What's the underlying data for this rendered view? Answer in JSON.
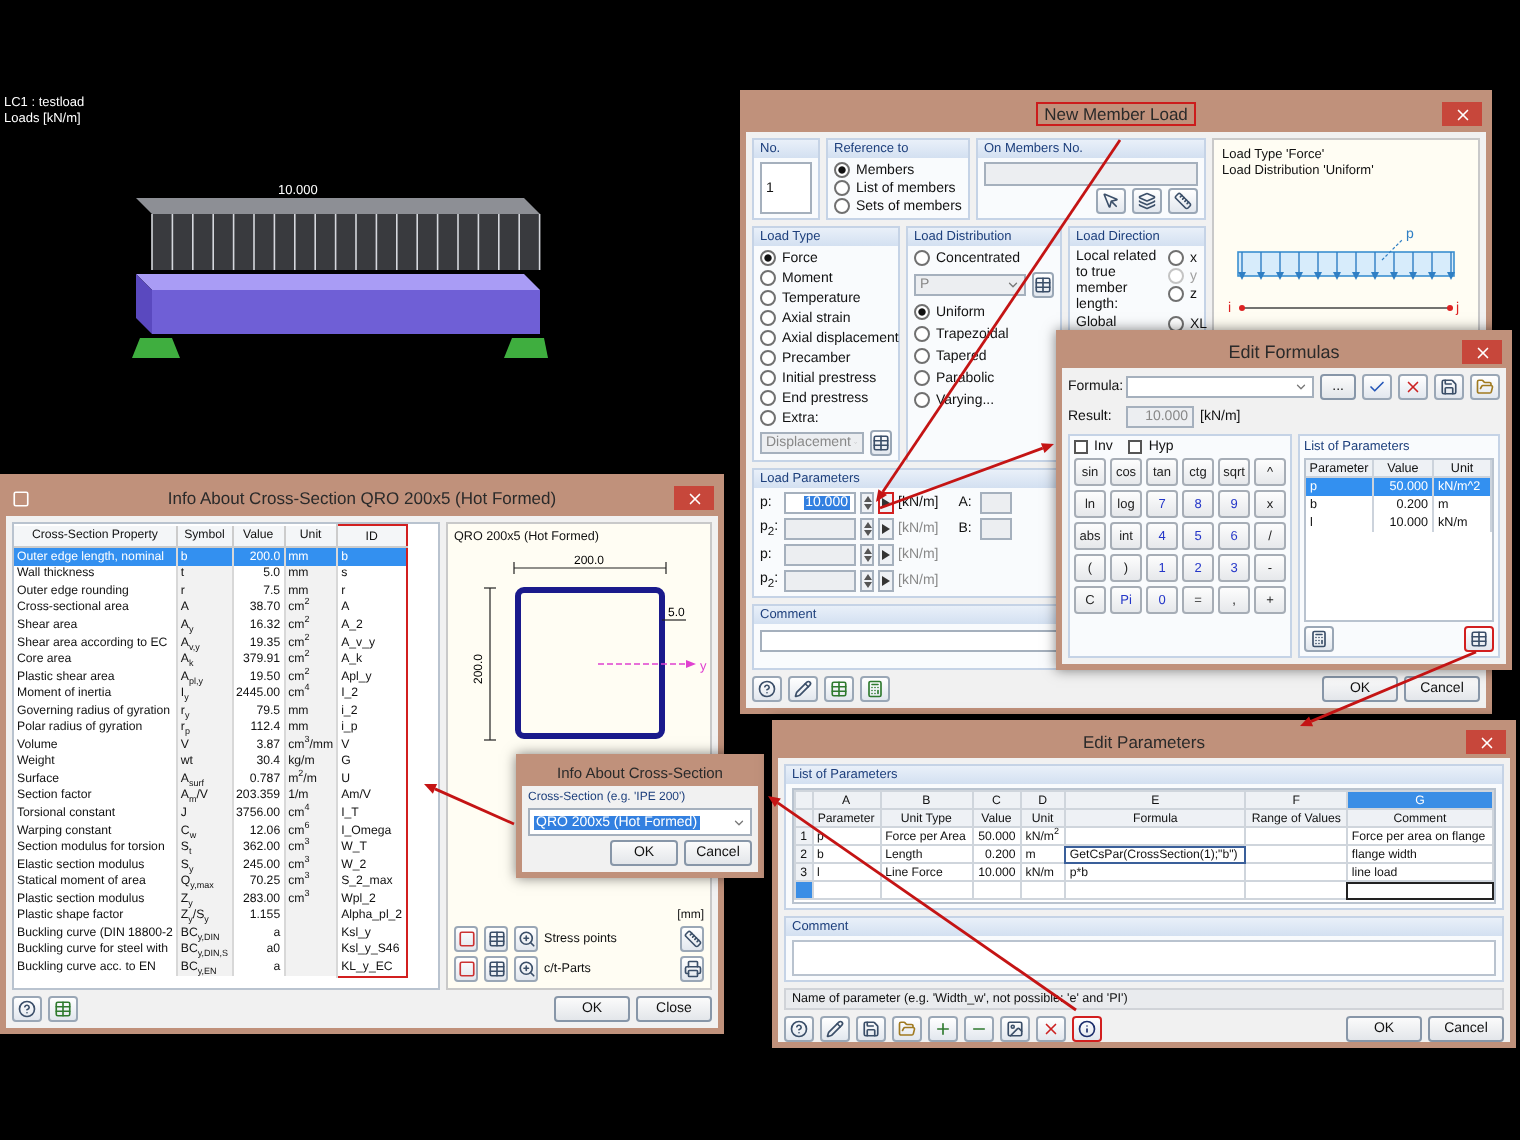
{
  "viewport": {
    "case_label": "LC1 : testload",
    "units_label": "Loads [kN/m]",
    "load_value": "10.000"
  },
  "member_load_dialog": {
    "title": "New Member Load",
    "title_highlighted": true,
    "number": {
      "label": "No.",
      "value": "1"
    },
    "reference": {
      "label": "Reference to",
      "options": [
        {
          "label": "Members",
          "selected": true
        },
        {
          "label": "List of members",
          "selected": false
        },
        {
          "label": "Sets of members",
          "selected": false
        }
      ]
    },
    "members": {
      "label": "On Members No."
    },
    "load_type": {
      "label": "Load Type",
      "options": [
        {
          "label": "Force",
          "selected": true
        },
        {
          "label": "Moment",
          "selected": false
        },
        {
          "label": "Temperature",
          "selected": false
        },
        {
          "label": "Axial strain",
          "selected": false
        },
        {
          "label": "Axial displacement",
          "selected": false
        },
        {
          "label": "Precamber",
          "selected": false
        },
        {
          "label": "Initial prestress",
          "selected": false
        },
        {
          "label": "End prestress",
          "selected": false
        },
        {
          "label": "Extra:",
          "selected": false,
          "value": "Displacement"
        }
      ]
    },
    "load_distribution": {
      "label": "Load Distribution",
      "options": [
        {
          "label": "Concentrated",
          "selected": false,
          "value": "P"
        },
        {
          "label": "Uniform",
          "selected": true
        },
        {
          "label": "Trapezoidal",
          "selected": false
        },
        {
          "label": "Tapered",
          "selected": false
        },
        {
          "label": "Parabolic",
          "selected": false
        },
        {
          "label": "Varying...",
          "selected": false
        }
      ]
    },
    "load_direction": {
      "label": "Load Direction",
      "local_label": "Local related to true member length:",
      "local_options": [
        {
          "label": "x",
          "selected": false,
          "disabled": false
        },
        {
          "label": "y",
          "selected": false,
          "disabled": true
        },
        {
          "label": "z",
          "selected": false,
          "disabled": false
        }
      ],
      "global_label": "Global",
      "global_options": [
        {
          "label": "XL",
          "selected": false,
          "disabled": false
        }
      ]
    },
    "load_parameters": {
      "label": "Load Parameters",
      "rows": [
        {
          "label": "p:",
          "value": "10.000",
          "unit": "[kN/m]",
          "disabled": false,
          "formula_highlighted": true
        },
        {
          "label": "p$_{2}$:",
          "unit": "[kN/m]",
          "disabled": true,
          "formula_highlighted": false
        },
        {
          "label": "p:",
          "unit": "[kN/m]",
          "disabled": true,
          "formula_highlighted": false
        },
        {
          "label": "p$_{2}$:",
          "unit": "[kN/m]",
          "disabled": true,
          "formula_highlighted": false
        }
      ],
      "distances": [
        {
          "label": "A:"
        },
        {
          "label": "B:"
        }
      ]
    },
    "comment": {
      "label": "Comment"
    },
    "preview": {
      "lines": [
        "Load Type 'Force'",
        "Load Distribution 'Uniform'"
      ],
      "load_symbol": "p",
      "start_node": "i",
      "end_node": "j"
    },
    "buttons": [
      "OK",
      "Cancel"
    ]
  },
  "formula_dialog": {
    "title": "Edit Formulas",
    "formula_label": "Formula:",
    "more_button": "...",
    "result_label": "Result:",
    "result_value": "10.000",
    "result_unit": "[kN/m]",
    "parameters_button_highlighted": true,
    "checks": [
      {
        "label": "Inv",
        "checked": false
      },
      {
        "label": "Hyp",
        "checked": false
      }
    ],
    "keys": [
      [
        {
          "label": "sin",
          "kind": "function"
        },
        {
          "label": "cos",
          "kind": "function"
        },
        {
          "label": "tan",
          "kind": "function"
        },
        {
          "label": "ctg",
          "kind": "function"
        },
        {
          "label": "sqrt",
          "kind": "function"
        },
        {
          "label": "^",
          "kind": "operator"
        }
      ],
      [
        {
          "label": "ln",
          "kind": "function"
        },
        {
          "label": "log",
          "kind": "function"
        },
        {
          "label": "7",
          "kind": "digit"
        },
        {
          "label": "8",
          "kind": "digit"
        },
        {
          "label": "9",
          "kind": "digit"
        },
        {
          "label": "x",
          "kind": "operator"
        }
      ],
      [
        {
          "label": "abs",
          "kind": "function"
        },
        {
          "label": "int",
          "kind": "function"
        },
        {
          "label": "4",
          "kind": "digit"
        },
        {
          "label": "5",
          "kind": "digit"
        },
        {
          "label": "6",
          "kind": "digit"
        },
        {
          "label": "/",
          "kind": "operator"
        }
      ],
      [
        {
          "label": "(",
          "kind": "operator"
        },
        {
          "label": ")",
          "kind": "operator"
        },
        {
          "label": "1",
          "kind": "digit"
        },
        {
          "label": "2",
          "kind": "digit"
        },
        {
          "label": "3",
          "kind": "digit"
        },
        {
          "label": "-",
          "kind": "operator"
        }
      ],
      [
        {
          "label": "C",
          "kind": "operator"
        },
        {
          "label": "Pi",
          "kind": "digit"
        },
        {
          "label": "0",
          "kind": "digit"
        },
        {
          "label": "=",
          "kind": "operator"
        },
        {
          "label": ",",
          "kind": "operator"
        },
        {
          "label": "+",
          "kind": "operator"
        }
      ]
    ],
    "parameters": {
      "title": "List of Parameters",
      "columns": [
        "Parameter",
        "Value",
        "Unit"
      ],
      "rows": [
        {
          "cells": [
            "p",
            "50.000",
            "kN/m^2"
          ],
          "selected": true
        },
        {
          "cells": [
            "b",
            "0.200",
            "m"
          ],
          "selected": false
        },
        {
          "cells": [
            "l",
            "10.000",
            "kN/m"
          ],
          "selected": false
        }
      ]
    }
  },
  "section_info": {
    "title": "Info About Cross-Section QRO 200x5 (Hot Formed)",
    "id_column_highlighted": true,
    "columns": [
      "Cross-Section Property",
      "Symbol",
      "Value",
      "Unit",
      "ID"
    ],
    "rows": [
      {
        "property": "Outer edge length, nominal",
        "symbol": "b",
        "value": "200.0",
        "unit": "mm",
        "id": "b",
        "selected": true
      },
      {
        "property": "Wall thickness",
        "symbol": "t",
        "value": "5.0",
        "unit": "mm",
        "id": "s",
        "selected": false
      },
      {
        "property": "Outer edge rounding",
        "symbol": "r",
        "value": "7.5",
        "unit": "mm",
        "id": "r",
        "selected": false
      },
      {
        "property": "Cross-sectional area",
        "symbol": "A",
        "value": "38.70",
        "unit": "cm$^{2}$",
        "id": "A",
        "selected": false
      },
      {
        "property": "Shear area",
        "symbol": "A$_{y}$",
        "value": "16.32",
        "unit": "cm$^{2}$",
        "id": "A_2",
        "selected": false
      },
      {
        "property": "Shear area according to EC",
        "symbol": "A$_{v,y}$",
        "value": "19.35",
        "unit": "cm$^{2}$",
        "id": "A_v_y",
        "selected": false
      },
      {
        "property": "Core area",
        "symbol": "A$_{k}$",
        "value": "379.91",
        "unit": "cm$^{2}$",
        "id": "A_k",
        "selected": false
      },
      {
        "property": "Plastic shear area",
        "symbol": "A$_{pl,y}$",
        "value": "19.50",
        "unit": "cm$^{2}$",
        "id": "Apl_y",
        "selected": false
      },
      {
        "property": "Moment of inertia",
        "symbol": "I$_{y}$",
        "value": "2445.00",
        "unit": "cm$^{4}$",
        "id": "I_2",
        "selected": false
      },
      {
        "property": "Governing radius of gyration",
        "symbol": "r$_{y}$",
        "value": "79.5",
        "unit": "mm",
        "id": "i_2",
        "selected": false
      },
      {
        "property": "Polar radius of gyration",
        "symbol": "r$_{p}$",
        "value": "112.4",
        "unit": "mm",
        "id": "i_p",
        "selected": false
      },
      {
        "property": "Volume",
        "symbol": "V",
        "value": "3.87",
        "unit": "cm$^{3}$/mm",
        "id": "V",
        "selected": false
      },
      {
        "property": "Weight",
        "symbol": "wt",
        "value": "30.4",
        "unit": "kg/m",
        "id": "G",
        "selected": false
      },
      {
        "property": "Surface",
        "symbol": "A$_{surf}$",
        "value": "0.787",
        "unit": "m$^{2}$/m",
        "id": "U",
        "selected": false
      },
      {
        "property": "Section factor",
        "symbol": "A$_{m}$/V",
        "value": "203.359",
        "unit": "1/m",
        "id": "Am/V",
        "selected": false
      },
      {
        "property": "Torsional constant",
        "symbol": "J",
        "value": "3756.00",
        "unit": "cm$^{4}$",
        "id": "I_T",
        "selected": false
      },
      {
        "property": "Warping constant",
        "symbol": "C$_{w}$",
        "value": "12.06",
        "unit": "cm$^{6}$",
        "id": "I_Omega",
        "selected": false
      },
      {
        "property": "Section modulus for torsion",
        "symbol": "S$_{t}$",
        "value": "362.00",
        "unit": "cm$^{3}$",
        "id": "W_T",
        "selected": false
      },
      {
        "property": "Elastic section modulus",
        "symbol": "S$_{y}$",
        "value": "245.00",
        "unit": "cm$^{3}$",
        "id": "W_2",
        "selected": false
      },
      {
        "property": "Statical moment of area",
        "symbol": "Q$_{y,max}$",
        "value": "70.25",
        "unit": "cm$^{3}$",
        "id": "S_2_max",
        "selected": false
      },
      {
        "property": "Plastic section modulus",
        "symbol": "Z$_{y}$",
        "value": "283.00",
        "unit": "cm$^{3}$",
        "id": "Wpl_2",
        "selected": false
      },
      {
        "property": "Plastic shape factor",
        "symbol": "Z$_{y}$/S$_{y}$",
        "value": "1.155",
        "id": "Alpha_pl_2",
        "selected": false
      },
      {
        "property": "Buckling curve (DIN 18800-2",
        "symbol": "BC$_{y,DIN}$",
        "value": "a",
        "id": "Ksl_y",
        "selected": false
      },
      {
        "property": "Buckling curve for steel with",
        "symbol": "BC$_{y,DIN,S}$",
        "value": "a0",
        "id": "Ksl_y_S46",
        "selected": false
      },
      {
        "property": "Buckling curve acc. to EN",
        "symbol": "BC$_{y,EN}$",
        "value": "a",
        "id": "KL_y_EC",
        "selected": false
      }
    ],
    "drawing": {
      "title": "QRO 200x5 (Hot Formed)",
      "width_dim": "200.0",
      "height_dim": "200.0",
      "thickness_dim": "5.0",
      "axis_label": "y",
      "units": "[mm]"
    },
    "options": [
      {
        "label": "Stress points"
      },
      {
        "label": "c/t-Parts"
      }
    ],
    "buttons": [
      "OK",
      "Close"
    ]
  },
  "lookup_dialog": {
    "title": "Info About Cross-Section",
    "label": "Cross-Section (e.g. 'IPE 200')",
    "value": "QRO 200x5 (Hot Formed)",
    "buttons": [
      "OK",
      "Cancel"
    ]
  },
  "parameters_dialog": {
    "title": "Edit Parameters",
    "list_title": "List of Parameters",
    "info_button_highlighted": true,
    "column_letters": [
      {
        "label": "A",
        "selected": false
      },
      {
        "label": "B",
        "selected": false
      },
      {
        "label": "C",
        "selected": false
      },
      {
        "label": "D",
        "selected": false
      },
      {
        "label": "E",
        "selected": false
      },
      {
        "label": "F",
        "selected": false
      },
      {
        "label": "G",
        "selected": true
      }
    ],
    "columns": [
      "Parameter",
      "Unit Type",
      "Value",
      "Unit",
      "Formula",
      "Range of Values",
      "Comment"
    ],
    "rows": [
      {
        "number": "1",
        "parameter": "p",
        "unit_type": "Force per Area",
        "value": "50.000",
        "unit": "kN/m$^{2}$",
        "comment": "Force per area on flange",
        "current": false
      },
      {
        "number": "2",
        "parameter": "b",
        "unit_type": "Length",
        "value": "0.200",
        "unit": "m",
        "formula": "GetCsPar(CrossSection(1);\"b\")",
        "comment": "flange width",
        "editing": true,
        "current": false
      },
      {
        "number": "3",
        "parameter": "l",
        "unit_type": "Line Force",
        "value": "10.000",
        "unit": "kN/m",
        "formula": "p*b",
        "comment": "line load",
        "current": false
      },
      {
        "current": true
      }
    ],
    "comment_label": "Comment",
    "hint": "Name of parameter (e.g. 'Width_w', not possible: 'e' and 'PI')",
    "buttons": [
      "OK",
      "Cancel"
    ]
  }
}
